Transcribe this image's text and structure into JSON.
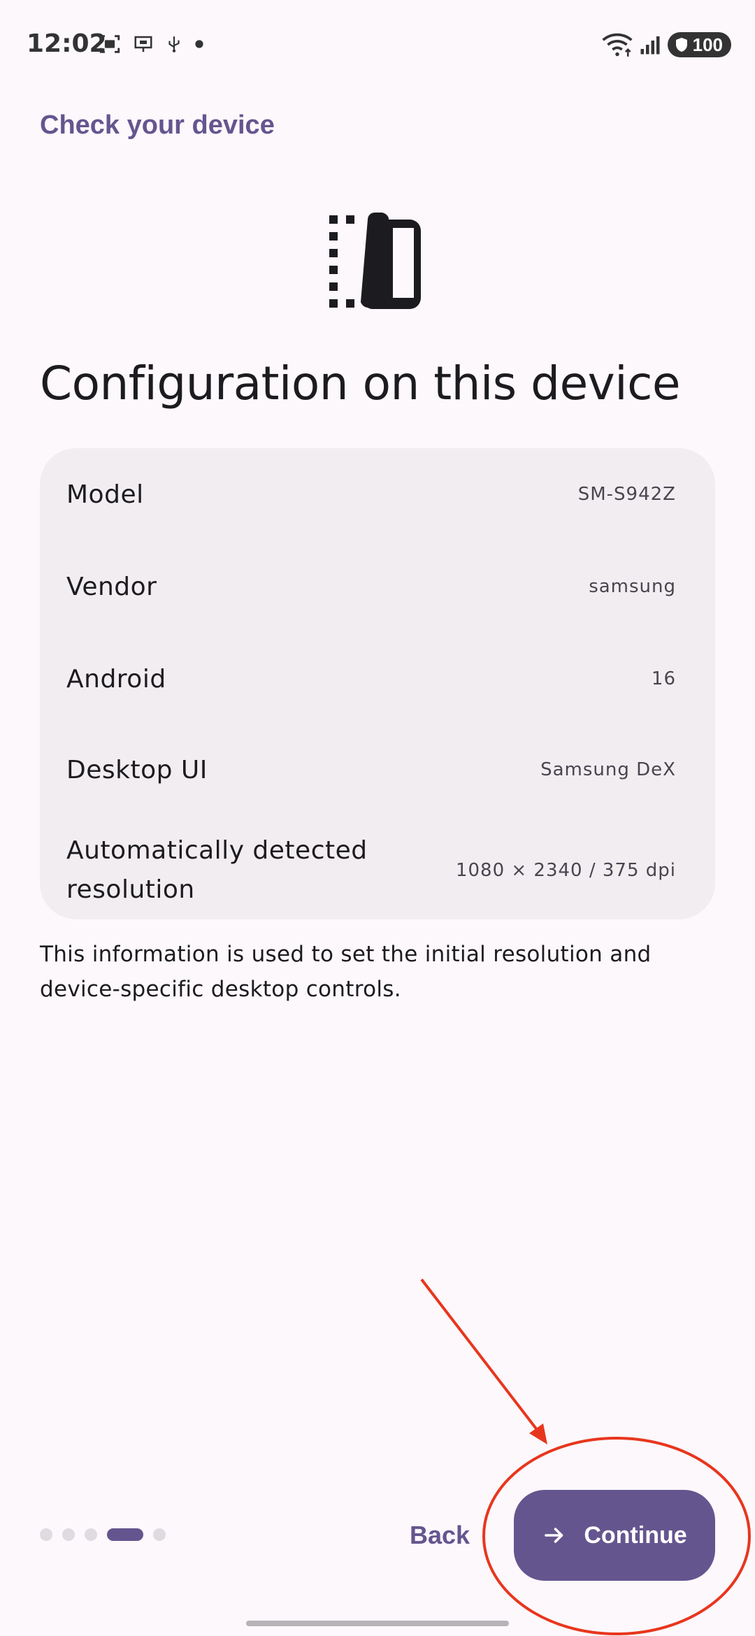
{
  "status_bar": {
    "time": "12:02",
    "battery": "100",
    "icons": [
      "screenshot-icon",
      "cast-icon",
      "usb-icon",
      "dot-icon",
      "wifi-icon",
      "signal-icon",
      "battery-icon"
    ]
  },
  "header": {
    "title": "Check your device"
  },
  "page": {
    "heading": "Configuration on this device"
  },
  "config": {
    "rows": [
      {
        "label": "Model",
        "value": "SM-S942Z"
      },
      {
        "label": "Vendor",
        "value": "samsung"
      },
      {
        "label": "Android",
        "value": "16"
      },
      {
        "label": "Desktop UI",
        "value": "Samsung DeX"
      },
      {
        "label": "Automatically detected resolution",
        "value": "1080 × 2340 / 375 dpi"
      }
    ]
  },
  "info_text": "This information is used to set the initial resolution and device-specific desktop controls.",
  "nav": {
    "pager": {
      "total": 5,
      "current": 4
    },
    "back_label": "Back",
    "continue_label": "Continue"
  },
  "colors": {
    "accent": "#65558F",
    "background": "#FCF8FC",
    "card": "#F1EDF1",
    "annotation": "#E8361E"
  }
}
